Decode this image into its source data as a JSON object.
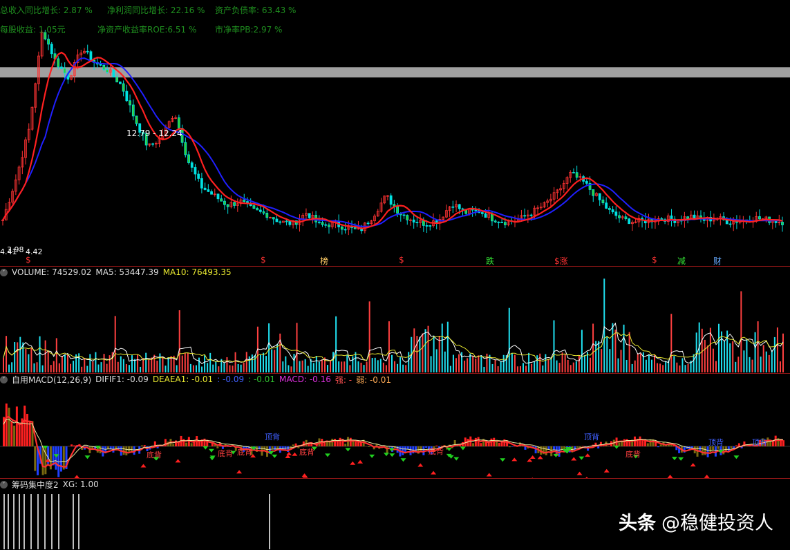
{
  "fundamentals": {
    "rev_growth": "总收入同比增长: 2.87 %",
    "profit_growth": "净利润同比增长: 22.16 %",
    "debt_ratio": "资产负债率: 63.43 %",
    "eps": "每股收益: 1.05元",
    "roe": "净资产收益率ROE:6.51 %",
    "pb": "市净率PB:2.97 %"
  },
  "price_panel": {
    "resistance_label": "12.79 - 12.24",
    "low_label_a": "4.41",
    "low_label_b": "3.98",
    "low_label_c": "4.42"
  },
  "markers": [
    {
      "label": "$",
      "color": "#ff3333"
    },
    {
      "label": "$",
      "color": "#ff3333"
    },
    {
      "label": "榜",
      "color": "#ffcc66"
    },
    {
      "label": "$",
      "color": "#ff3333"
    },
    {
      "label": "跌",
      "color": "#33dd33"
    },
    {
      "label": "$涨",
      "color": "#ff3333"
    },
    {
      "label": "$",
      "color": "#ff3333"
    },
    {
      "label": "减",
      "color": "#33dd33"
    },
    {
      "label": "财",
      "color": "#66aaff"
    }
  ],
  "volume": {
    "title": "VOLUME: 74529.02",
    "ma5": "MA5: 53447.39",
    "ma10": "MA10: 76493.35"
  },
  "macd": {
    "title": "自用MACD(12,26,9)",
    "dif": "DIFIF1: -0.09",
    "dea": "DEAEA1: -0.01",
    "c1": ": -0.09",
    "c2": ": -0.01",
    "macd": "MACD: -0.16",
    "strong": "强: -",
    "weak": "弱: -0.01",
    "signal_top": "顶背",
    "signal_bottom": "底背"
  },
  "chip": {
    "title": "筹码集中度2",
    "xg": "XG: 1.00"
  },
  "watermark": {
    "logo": "头条",
    "author": "@稳健投资人"
  },
  "colors": {
    "up": "#ff3333",
    "down": "#00e0e0",
    "ma_short": "#ff2020",
    "ma_long": "#2020ff",
    "resistance_band": "#a0a0a0",
    "panel_border": "#8a1515"
  },
  "chart_data": {
    "type": "line",
    "series": [
      {
        "values": [
          4.6,
          6.8,
          9.5,
          14.8,
          13.1,
          12.2,
          13.8,
          13.0,
          12.6,
          11.8,
          10.0,
          8.5,
          9.0,
          10.4,
          7.8,
          6.4,
          5.9,
          5.4,
          5.6,
          5.1,
          4.9,
          4.5,
          4.4,
          5.0,
          4.3,
          4.4,
          4.2,
          4.0,
          4.8,
          5.9,
          5.0,
          4.6,
          4.4,
          4.6,
          5.5,
          5.0,
          5.1,
          4.7,
          4.5,
          4.6,
          5.0,
          5.4,
          6.1,
          7.1,
          6.6,
          5.8,
          5.0,
          4.6,
          4.5,
          4.6,
          4.7,
          4.6,
          4.8,
          4.6,
          4.7,
          4.5,
          4.6,
          4.7,
          4.6,
          4.5
        ]
      }
    ]
  }
}
